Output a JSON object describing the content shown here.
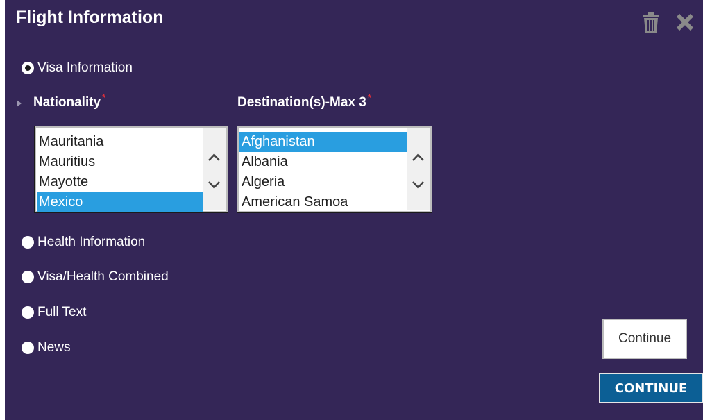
{
  "dialog": {
    "title": "Flight Information"
  },
  "options": {
    "visa": "Visa Information",
    "health": "Health Information",
    "combined": "Visa/Health Combined",
    "fulltext": "Full Text",
    "news": "News"
  },
  "nationality": {
    "label": "Nationality",
    "required_mark": "*",
    "items": [
      "Mauritania",
      "Mauritius",
      "Mayotte",
      "Mexico"
    ],
    "selected": "Mexico"
  },
  "destinations": {
    "label": "Destination(s)-Max 3",
    "required_mark": "*",
    "items": [
      "Afghanistan",
      "Albania",
      "Algeria",
      "American Samoa"
    ],
    "selected": "Afghanistan"
  },
  "buttons": {
    "continue_outline": "Continue",
    "continue_primary": "CONTINUE"
  },
  "colors": {
    "panel_bg": "#342657",
    "selection": "#299ee0",
    "primary_button": "#0c5f95",
    "required": "#e0303a"
  },
  "icons": [
    "trash-icon",
    "close-icon",
    "expand-triangle-icon",
    "chevron-up-icon",
    "chevron-down-icon"
  ]
}
